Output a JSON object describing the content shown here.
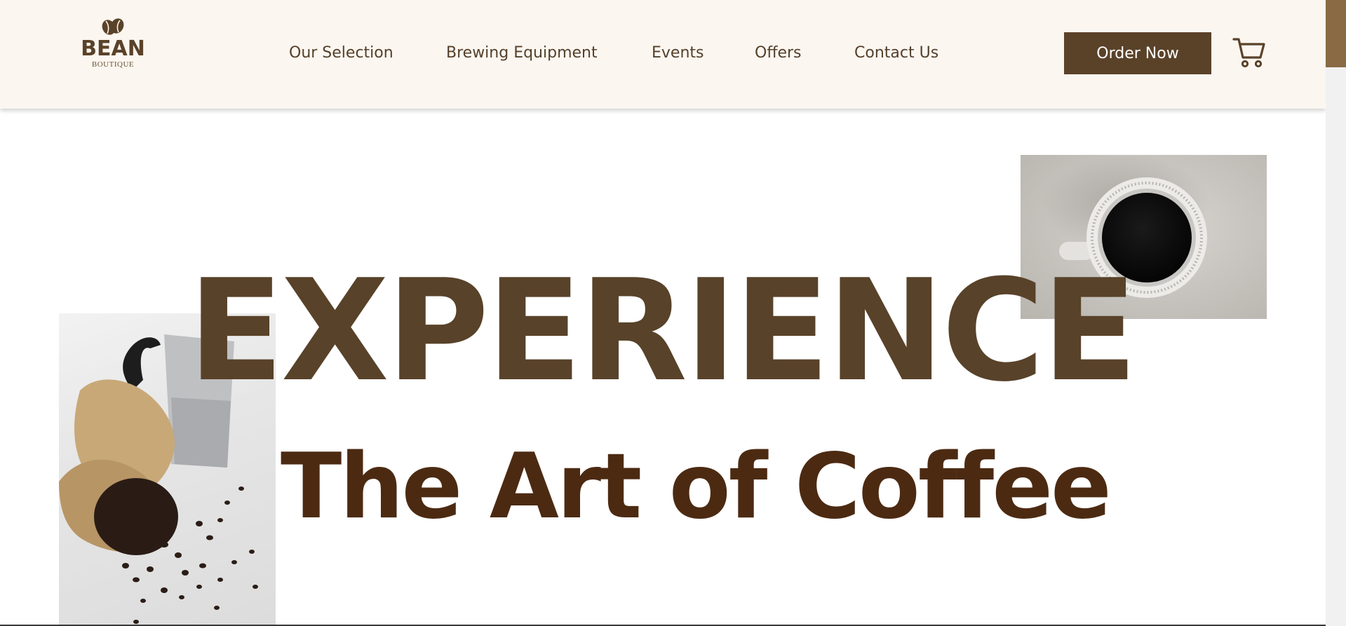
{
  "brand": {
    "name": "BEAN",
    "tagline": "BOUTIQUE",
    "logo_icon": "coffee-bean-icon"
  },
  "nav": {
    "items": [
      {
        "label": "Our Selection"
      },
      {
        "label": "Brewing Equipment"
      },
      {
        "label": "Events"
      },
      {
        "label": "Offers"
      },
      {
        "label": "Contact Us"
      }
    ]
  },
  "cta": {
    "order_label": "Order Now"
  },
  "cart": {
    "icon": "shopping-cart-icon"
  },
  "hero": {
    "headline": "EXPERIENCE",
    "subheadline": "The Art of Coffee",
    "images": [
      {
        "name": "coffee-cup-photo"
      },
      {
        "name": "coffee-beans-photo"
      }
    ]
  },
  "colors": {
    "header_bg": "#fbf6f0",
    "brand_brown": "#5a4229",
    "headline": "#584229",
    "subheadline": "#4c2a12",
    "scroll_thumb": "#8a6a45"
  }
}
